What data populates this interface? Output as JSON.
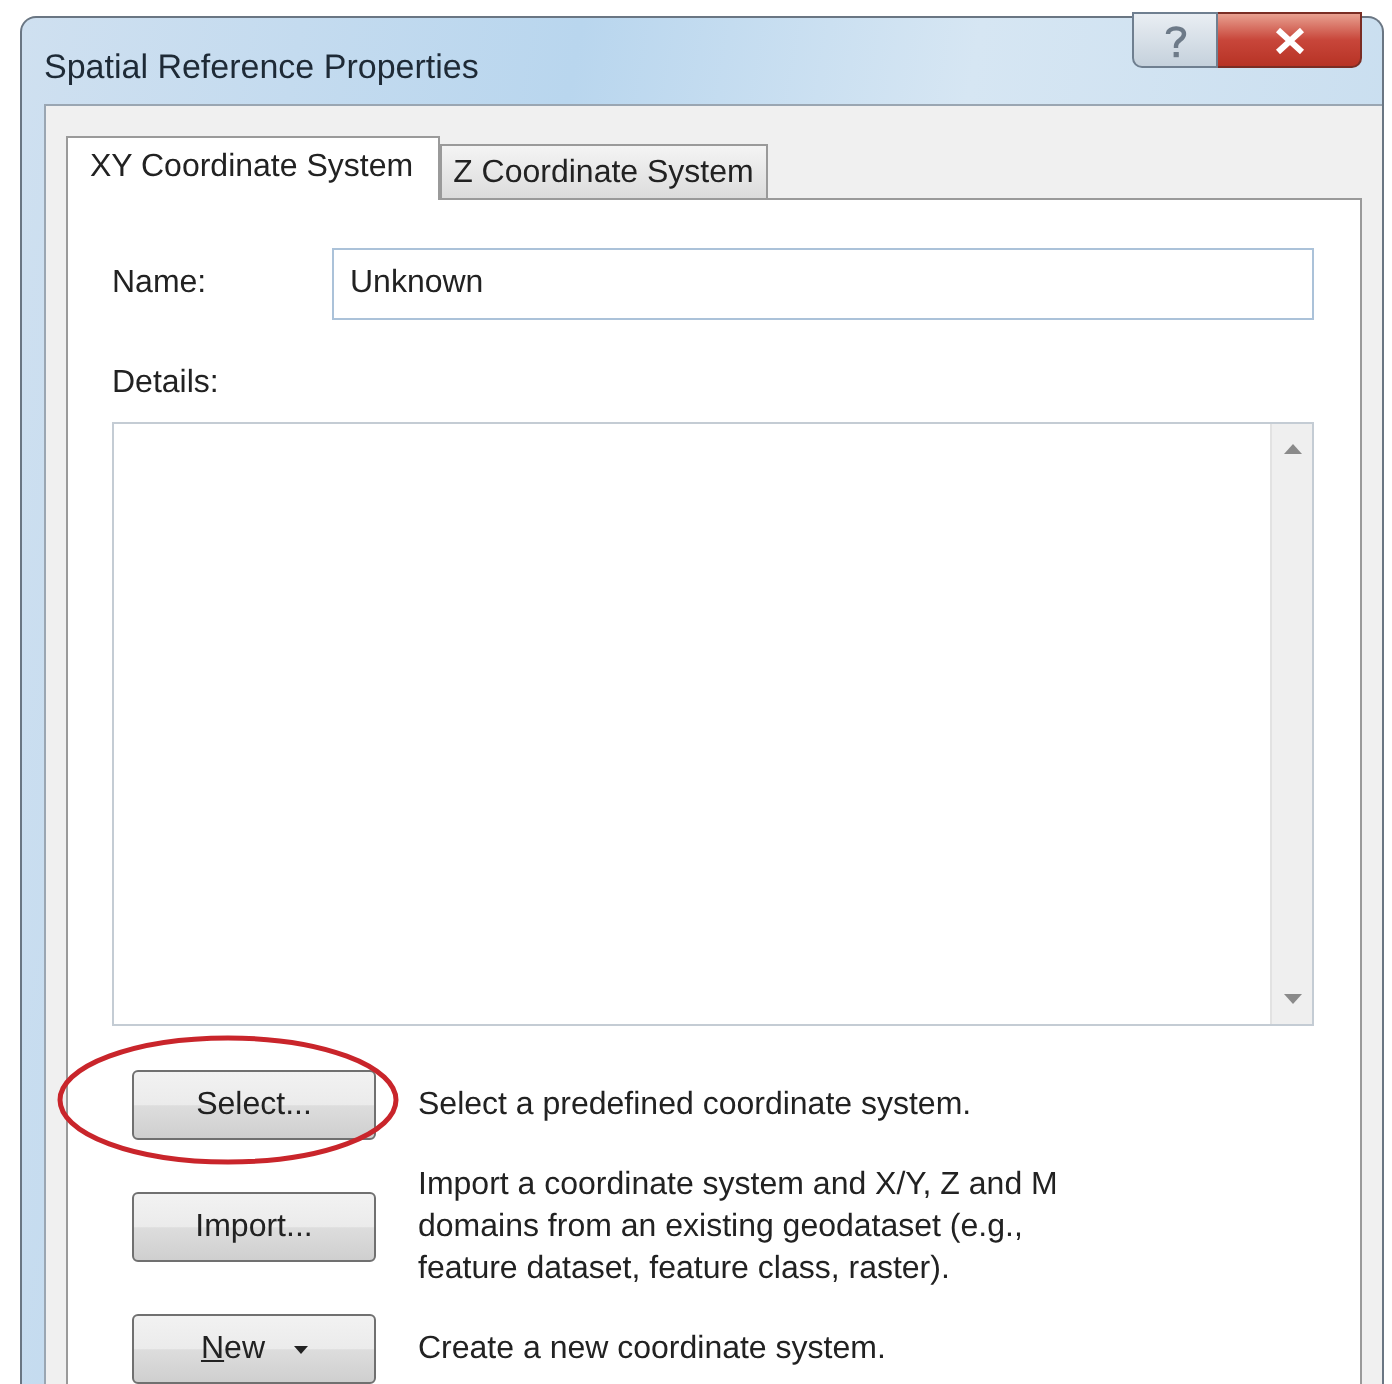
{
  "window": {
    "title": "Spatial Reference Properties"
  },
  "tabs": [
    {
      "label": "XY Coordinate System",
      "selected": true
    },
    {
      "label": "Z Coordinate System",
      "selected": false
    }
  ],
  "name_field": {
    "label": "Name:",
    "value": "Unknown"
  },
  "details": {
    "label": "Details:"
  },
  "actions": [
    {
      "kind": "button",
      "label": "Select...",
      "description": "Select a predefined coordinate system.",
      "highlighted": true
    },
    {
      "kind": "button",
      "label": "Import...",
      "description": "Import a coordinate system and X/Y, Z and M domains from an existing geodataset (e.g., feature dataset, feature class, raster).",
      "highlighted": false
    },
    {
      "kind": "split",
      "label": "New",
      "description": "Create a new coordinate system.",
      "highlighted": false
    }
  ]
}
